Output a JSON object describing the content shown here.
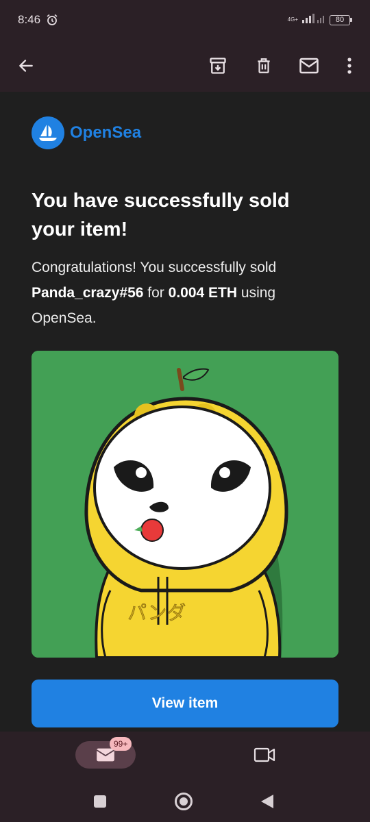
{
  "status_bar": {
    "time": "8:46",
    "network": "4G+",
    "battery": "80"
  },
  "app_bar": {
    "back_icon": "arrow-back-icon",
    "archive_icon": "archive-icon",
    "delete_icon": "trash-icon",
    "mark_unread_icon": "mail-icon",
    "more_icon": "more-vert-icon"
  },
  "email": {
    "logo_text": "OpenSea",
    "headline": "You have successfully sold your item!",
    "body_intro": "Congratulations! You successfully sold",
    "item_name": "Panda_crazy#56",
    "for_text": "for",
    "price": "0.004 ETH",
    "using_text": "using",
    "platform": "OpenSea.",
    "nft_hood_text": "パンダ",
    "view_button": "View item"
  },
  "bottom_nav": {
    "mail_badge": "99+",
    "mail_icon": "mail-icon",
    "meet_icon": "video-icon"
  },
  "colors": {
    "accent": "#2081e2",
    "bar": "#2b2026",
    "background": "#1f1f1f"
  }
}
